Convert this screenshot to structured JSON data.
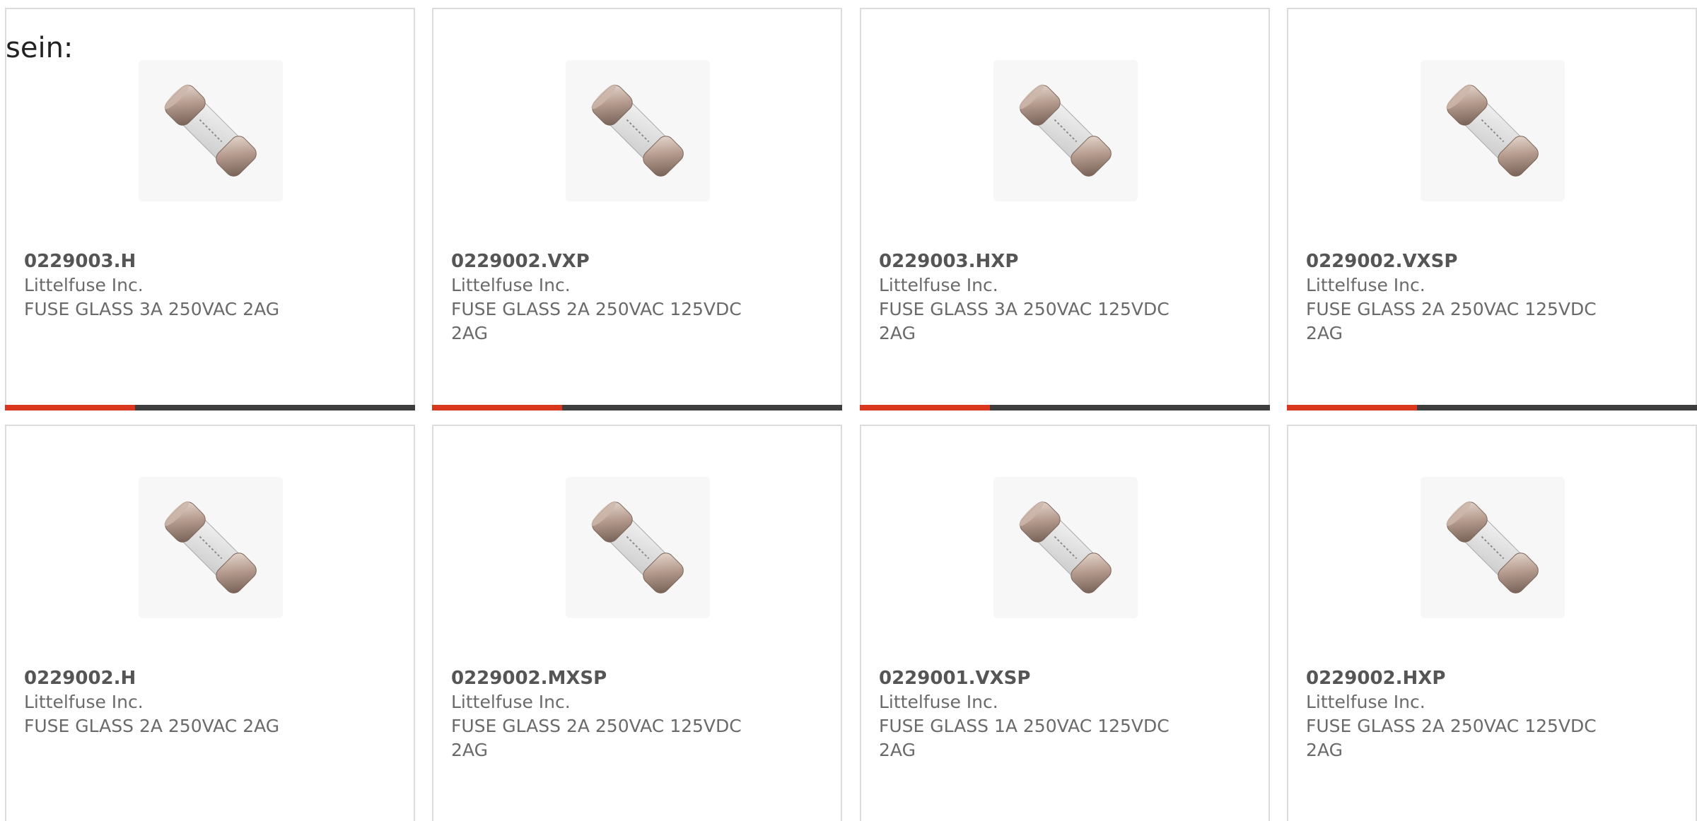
{
  "intro": {
    "text": "sein:"
  },
  "colors": {
    "accent": "#d9381e",
    "bar": "#3e3e3e",
    "card_border": "#dcdcdc"
  },
  "products": [
    {
      "part_number": "0229003.H",
      "manufacturer": "Littelfuse Inc.",
      "description": "FUSE GLASS 3A 250VAC 2AG",
      "image_icon": "glass-fuse-icon"
    },
    {
      "part_number": "0229002.VXP",
      "manufacturer": "Littelfuse Inc.",
      "description": "FUSE GLASS 2A 250VAC 125VDC 2AG",
      "image_icon": "glass-fuse-icon"
    },
    {
      "part_number": "0229003.HXP",
      "manufacturer": "Littelfuse Inc.",
      "description": "FUSE GLASS 3A 250VAC 125VDC 2AG",
      "image_icon": "glass-fuse-icon"
    },
    {
      "part_number": "0229002.VXSP",
      "manufacturer": "Littelfuse Inc.",
      "description": "FUSE GLASS 2A 250VAC 125VDC 2AG",
      "image_icon": "glass-fuse-icon"
    },
    {
      "part_number": "0229002.H",
      "manufacturer": "Littelfuse Inc.",
      "description": "FUSE GLASS 2A 250VAC 2AG",
      "image_icon": "glass-fuse-icon"
    },
    {
      "part_number": "0229002.MXSP",
      "manufacturer": "Littelfuse Inc.",
      "description": "FUSE GLASS 2A 250VAC 125VDC 2AG",
      "image_icon": "glass-fuse-icon"
    },
    {
      "part_number": "0229001.VXSP",
      "manufacturer": "Littelfuse Inc.",
      "description": "FUSE GLASS 1A 250VAC 125VDC 2AG",
      "image_icon": "glass-fuse-icon"
    },
    {
      "part_number": "0229002.HXP",
      "manufacturer": "Littelfuse Inc.",
      "description": "FUSE GLASS 2A 250VAC 125VDC 2AG",
      "image_icon": "glass-fuse-icon"
    }
  ]
}
